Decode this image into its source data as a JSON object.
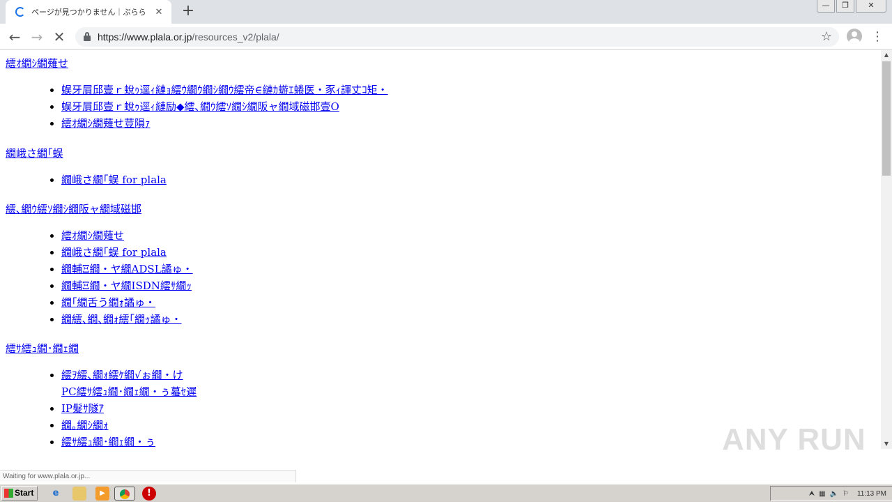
{
  "browser": {
    "tab_title": "ページが見つかりません｜ぷらら",
    "url_host": "https://www.plala.or.jp",
    "url_path": "/resources_v2/plala/",
    "status_text": "Waiting for www.plala.or.jp..."
  },
  "content": {
    "sections": [
      {
        "heading": "繧ｵ繝ｼ繝薙せ",
        "items": [
          "蜈牙屓邱壹ｒ蛻ｩ逕ｨ縺ｮ繧ｳ繝ｳ繝ｼ繝ｳ繧帝∈縺ｶ蝣ｴ蜷医・豕ｨ諢丈ｺ矩・",
          "蜈牙屓邱壹ｒ蛻ｩ逕ｨ縺励◆繧､繝ｳ繧ｿ繝ｼ繝阪ャ繝域磁邯壹Ο",
          "繧ｵ繝ｼ繝薙せ荳隕ｧ"
        ]
      },
      {
        "heading": "繝峨さ繝｢蜈",
        "items": [
          "繝峨さ繝｢蜈 for plala"
        ]
      },
      {
        "heading": "繧､繝ｳ繧ｿ繝ｼ繝阪ャ繝域磁邯",
        "items": [
          "繧ｵ繝ｼ繝薙せ",
          "繝峨さ繝｢蜈 for plala",
          "繝輔Ξ繝・ヤ繝ADSL譎ゅ・",
          "繝輔Ξ繝・ヤ繝ISDN繧ｻ繝ｯ",
          "繝｢繝舌う繝ｫ譎ゅ・",
          "繝繧､繝､繝ｫ繧｢繝ｯ譎ゅ・"
        ]
      },
      {
        "heading": "繧ｻ繧ｭ繝･繝ｪ繝",
        "items": [
          "繧ｦ繧､繝ｫ繧ｹ繝√ぉ繝・け",
          "PC繧ｻ繧ｭ繝･繝ｪ繝・ぅ蟇ｾ遲",
          "IP髮ｻ隧ｱ",
          "繝｡繝ｼ繝ｫ",
          "繧ｻ繧ｭ繝･繝ｪ繝・ぅ"
        ]
      }
    ]
  },
  "watermark": "ANY RUN",
  "taskbar": {
    "start_label": "Start",
    "clock": "11:13 PM"
  }
}
